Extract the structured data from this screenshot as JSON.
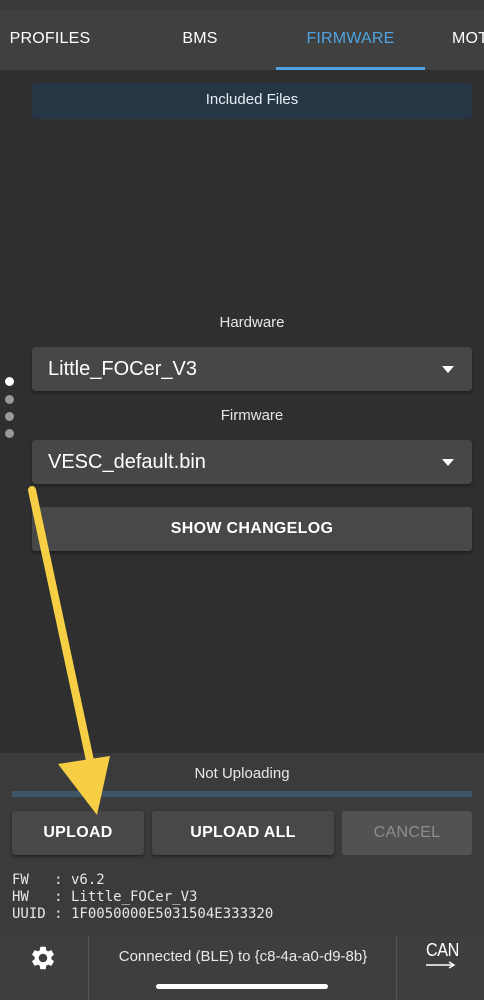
{
  "tabs": [
    {
      "label": "PROFILES",
      "active": false
    },
    {
      "label": "BMS",
      "active": false
    },
    {
      "label": "FIRMWARE",
      "active": true
    },
    {
      "label": "MOT",
      "active": false
    }
  ],
  "firmware": {
    "included_files_label": "Included Files",
    "hardware_label": "Hardware",
    "hardware_value": "Little_FOCer_V3",
    "firmware_label": "Firmware",
    "firmware_value": "VESC_default.bin",
    "changelog_button": "SHOW CHANGELOG"
  },
  "page_indicator": {
    "count": 4,
    "active_index": 0
  },
  "upload": {
    "status": "Not Uploading",
    "progress_percent": 0,
    "upload_button": "UPLOAD",
    "upload_all_button": "UPLOAD ALL",
    "cancel_button": "CANCEL",
    "cancel_enabled": false
  },
  "device_info": {
    "fw": "FW   : v6.2",
    "hw": "HW   : Little_FOCer_V3",
    "uuid": "UUID : 1F0050000E5031504E333320"
  },
  "statusbar": {
    "settings_icon": "gear-icon",
    "connection": "Connected (BLE) to {c8-4a-a0-d9-8b}",
    "can_label": "CAN"
  },
  "annotation": {
    "shape": "arrow",
    "color": "#f7cf45",
    "points_to": "UPLOAD"
  },
  "colors": {
    "accent": "#4fa3e0",
    "background": "#2f2f2f",
    "panel": "#3b3b3b",
    "button": "#484848",
    "included_bg": "#263645"
  }
}
